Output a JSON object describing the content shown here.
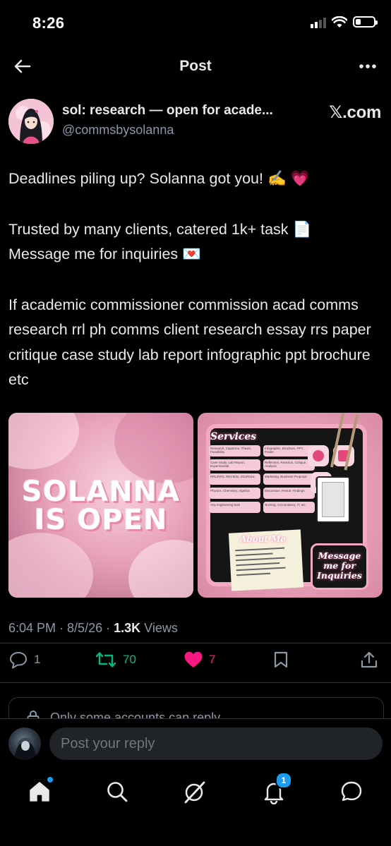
{
  "status": {
    "time": "8:26"
  },
  "nav": {
    "title": "Post"
  },
  "author": {
    "name": "sol: research — open for acade...",
    "handle": "@commsbysolanna",
    "source": "𝕏.com"
  },
  "post": {
    "line1": "Deadlines piling up? Solanna got you! ✍️ 💗",
    "line2": "Trusted by many clients, catered 1k+ task 📄",
    "line3": "Message me for inquiries 💌",
    "line4": "If academic commissioner commission acad comms research rrl ph comms client research essay rrs paper critique case study lab report infographic ppt brochure etc"
  },
  "media": {
    "left_text_line1": "SOLANNA",
    "left_text_line2": "IS OPEN",
    "right_services_title": "Services",
    "right_services": [
      [
        "Research, Capstone, Thesis, Feasibility",
        "Infographic, Brochure, PPT, Poster"
      ],
      [
        "Case Study, Lab Report, Experimental",
        "Reflection, Reaction, Critique, Analysis"
      ],
      [
        "RRL/RRS, REVIEW, JOURNAL",
        "Marketing, Business Proposal"
      ],
      [
        "Physics, Chemistry, Algebra",
        "Discussion, Result, Findings"
      ],
      [
        "Any engineering task",
        "Nursing, Accountancy, IT, etc."
      ]
    ],
    "right_about_title": "About Me",
    "right_message_line1": "Message",
    "right_message_line2": "me for",
    "right_message_line3": "Inquiries"
  },
  "meta": {
    "time": "6:04 PM",
    "date": "8/5/26",
    "views_count": "1.3K",
    "views_label": "Views"
  },
  "actions": {
    "replies": "1",
    "reposts": "70",
    "likes": "7"
  },
  "reply_restriction": "Only some accounts can reply",
  "composer": {
    "placeholder": "Post your reply"
  },
  "tabbar": {
    "notifications_count": "1"
  },
  "colors": {
    "background": "#000000",
    "text": "#e7e9ea",
    "muted": "#8b98a5",
    "repost": "#00ba7c",
    "like": "#f91880",
    "accent": "#1d9bf0"
  }
}
